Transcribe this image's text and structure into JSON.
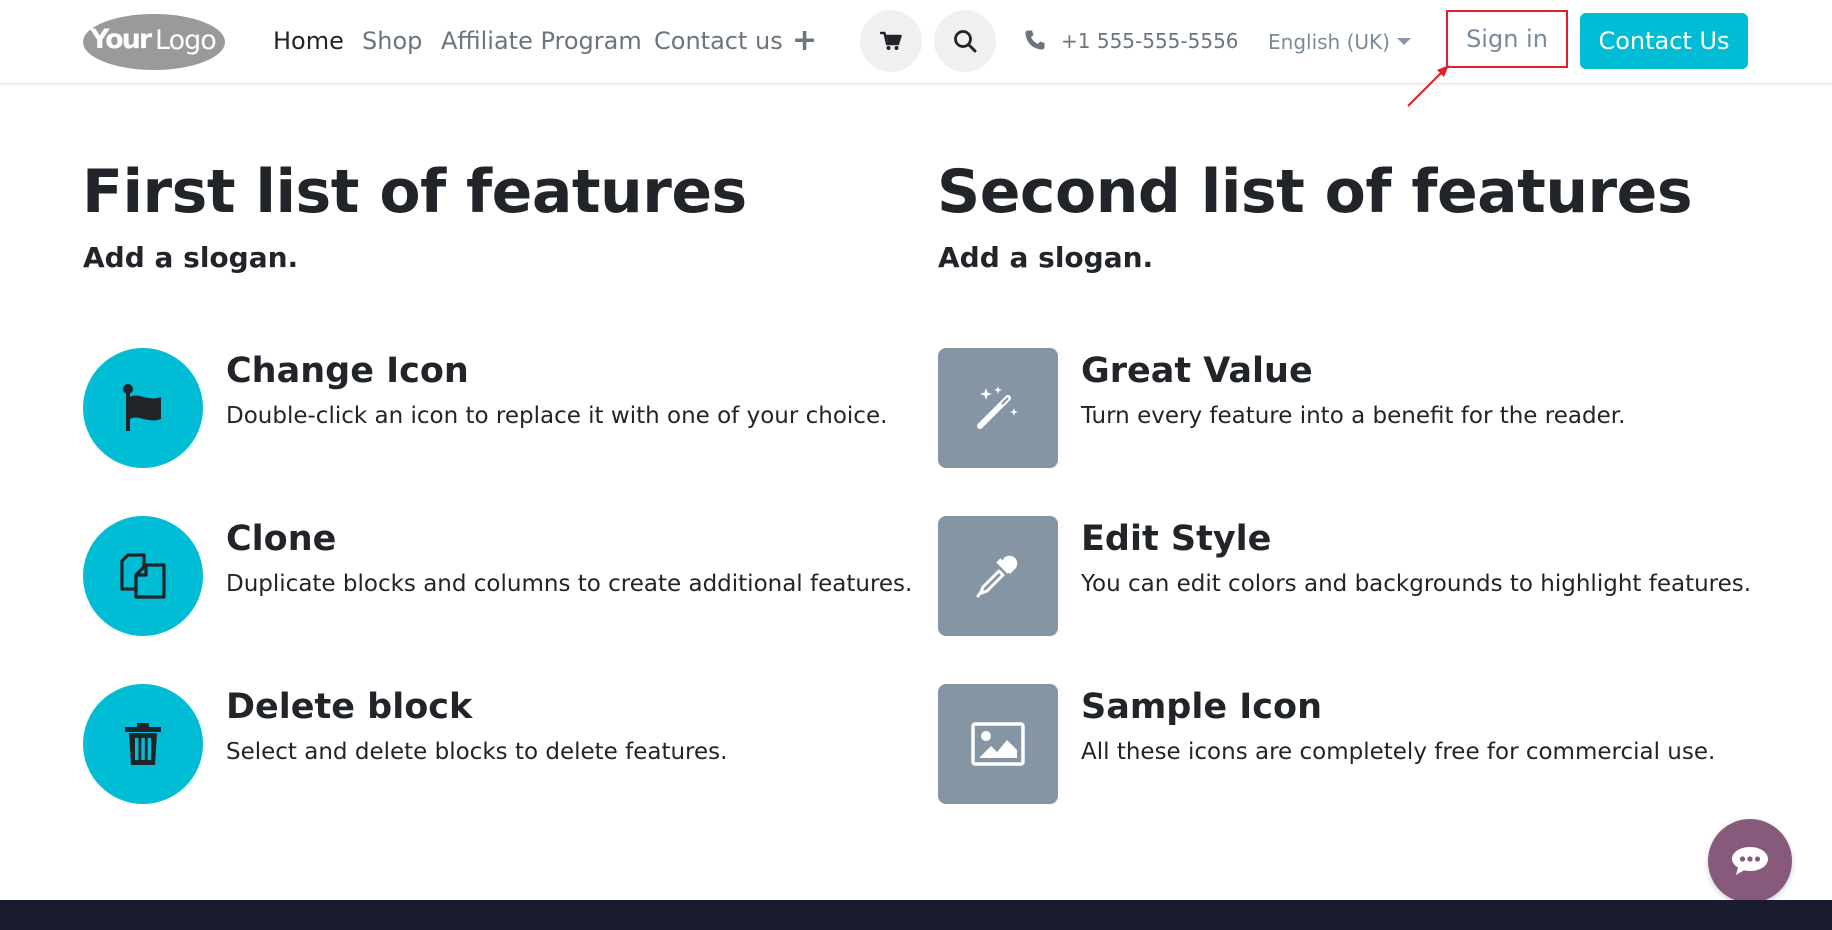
{
  "header": {
    "logo_text": "YourLogo",
    "nav": [
      {
        "label": "Home",
        "active": true
      },
      {
        "label": "Shop",
        "active": false
      },
      {
        "label": "Affiliate Program",
        "active": false
      },
      {
        "label": "Contact us",
        "active": false
      }
    ],
    "add_menu_icon": "plus-icon",
    "cart_icon": "cart-icon",
    "search_icon": "search-icon",
    "phone_icon": "phone-icon",
    "phone": "+1 555-555-5556",
    "language": "English (UK)",
    "signin_label": "Sign in",
    "contact_label": "Contact Us"
  },
  "colors": {
    "accent": "#00bcd4",
    "square_badge": "#8595a3",
    "highlight": "#e0202a",
    "chat": "#875a7b",
    "footer": "#191b2e"
  },
  "sections": [
    {
      "title": "First list of features",
      "slogan": "Add a slogan.",
      "features": [
        {
          "icon": "flag-icon",
          "title": "Change Icon",
          "desc": "Double-click an icon to replace it with one of your choice."
        },
        {
          "icon": "clone-icon",
          "title": "Clone",
          "desc": "Duplicate blocks and columns to create additional features."
        },
        {
          "icon": "trash-icon",
          "title": "Delete block",
          "desc": "Select and delete blocks to delete features."
        }
      ]
    },
    {
      "title": "Second list of features",
      "slogan": "Add a slogan.",
      "features": [
        {
          "icon": "magic-wand-icon",
          "title": "Great Value",
          "desc": "Turn every feature into a benefit for the reader."
        },
        {
          "icon": "eyedropper-icon",
          "title": "Edit Style",
          "desc": "You can edit colors and backgrounds to highlight features."
        },
        {
          "icon": "image-icon",
          "title": "Sample Icon",
          "desc": "All these icons are completely free for commercial use."
        }
      ]
    }
  ],
  "chat_icon": "chat-bubble-icon"
}
